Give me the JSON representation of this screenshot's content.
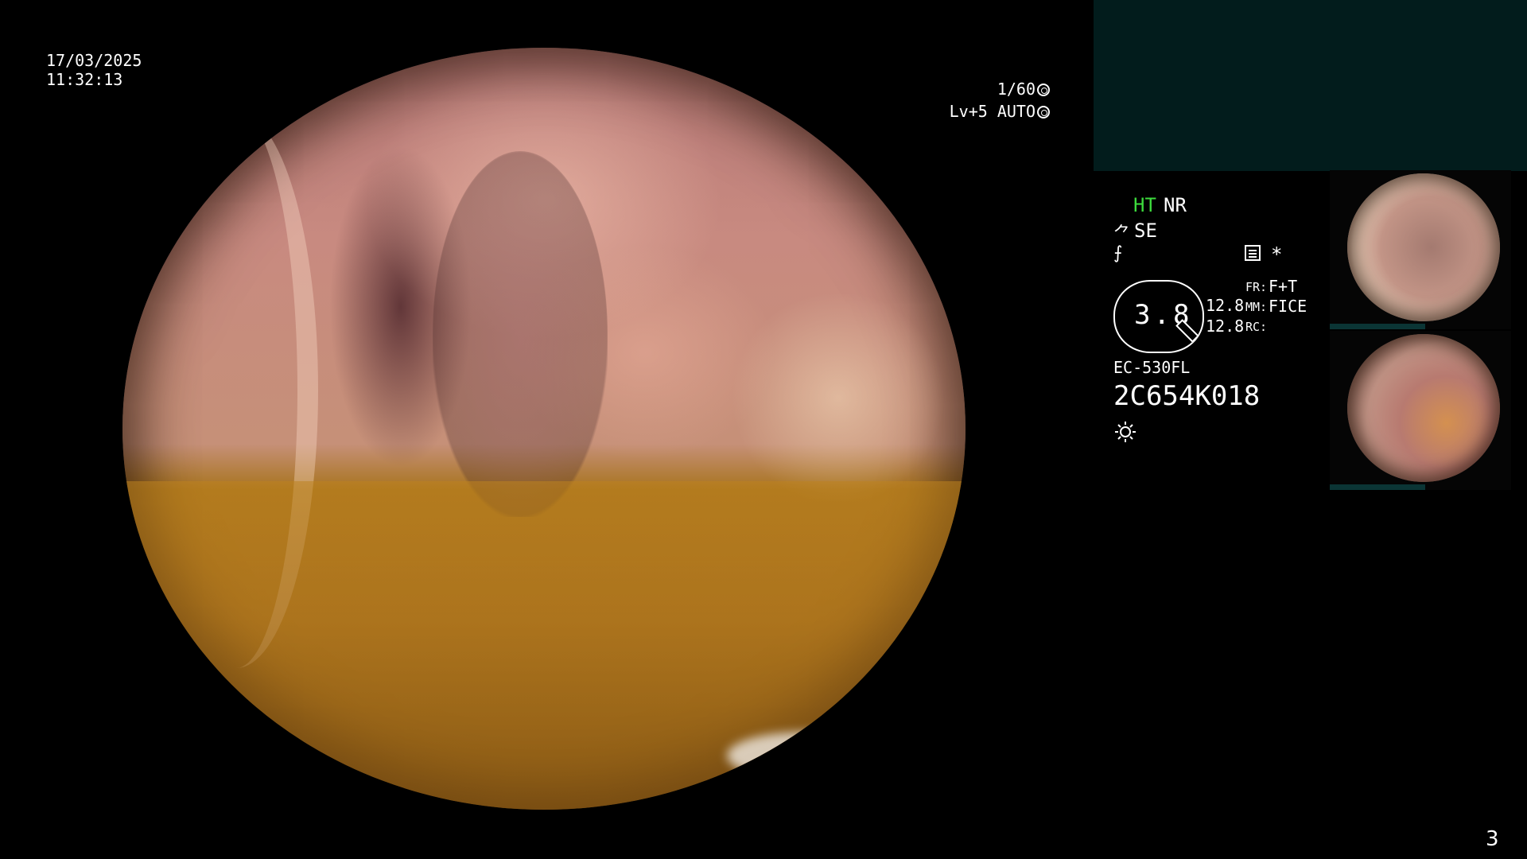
{
  "header": {
    "date": "17/03/2025",
    "time": "11:32:13",
    "shutter": "1/60",
    "level": "Lv+5 AUTO"
  },
  "status": {
    "ht": "HT",
    "nr": "NR",
    "se": "SE",
    "star": "*"
  },
  "zoom": {
    "value": "3.8",
    "v1": "12.8",
    "v2": "12.8",
    "fr_label": "FR:",
    "fr_value": "F+T",
    "mm_label": "MM:",
    "mm_value": "FICE",
    "rc_label": "RC:"
  },
  "device": {
    "model": "EC-530FL",
    "serial": "2C654K018"
  },
  "footer": {
    "page_number": "3"
  },
  "colors": {
    "ht_green": "#3ddc3d",
    "panel_teal": "#021c1c"
  },
  "icons": [
    "shutter-icon",
    "auto-iris-icon",
    "se-icon",
    "mode-icon",
    "memo-icon",
    "light-icon"
  ]
}
